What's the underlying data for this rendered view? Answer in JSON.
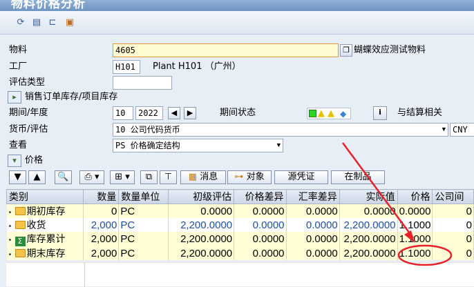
{
  "window": {
    "title": "物料价格分析"
  },
  "toolbar": {
    "icons": [
      "refresh-icon",
      "list-icon",
      "hierarchy-icon",
      "settings-icon"
    ]
  },
  "form": {
    "material": {
      "label": "物料",
      "value": "4605",
      "description": "蝴蝶效应测试物料"
    },
    "plant": {
      "label": "工厂",
      "value": "H101",
      "description": "Plant H101 （广州）"
    },
    "valuation_type": {
      "label": "评估类型",
      "value": ""
    },
    "sales_order_stock": {
      "label": "销售订单库存/项目库存"
    },
    "period_year": {
      "label": "期间/年度",
      "period": "10",
      "year": "2022",
      "status_label": "期间状态",
      "closing_label": "与结算相关"
    },
    "currency": {
      "label": "货币/评估",
      "value": "10 公司代码货币",
      "currency_code": "CNY"
    },
    "view": {
      "label": "查看",
      "value": "PS 价格确定结构"
    },
    "price_section": {
      "label": "价格"
    }
  },
  "alv_toolbar": {
    "messages_label": "消息",
    "objects_label": "对象",
    "source_doc_label": "源凭证",
    "wip_label": "在制品"
  },
  "grid": {
    "columns": [
      "类别",
      "数量",
      "数量单位",
      "初级评估",
      "价格差异",
      "汇率差异",
      "实际值",
      "价格",
      "公司间"
    ],
    "rows": [
      {
        "category": "期初库存",
        "icon": "folder-icon",
        "qty": "0",
        "unit": "PC",
        "prelim": "0.0000",
        "price_diff": "0.0000",
        "exch_diff": "0.0000",
        "actual": "0.0000",
        "price": "0.0000",
        "ic": "0",
        "style": "yellow"
      },
      {
        "category": "收货",
        "icon": "folder-icon",
        "qty": "2,000",
        "unit": "PC",
        "prelim": "2,200.0000",
        "price_diff": "0.0000",
        "exch_diff": "0.0000",
        "actual": "2,200.0000",
        "price": "1.1000",
        "ic": "0",
        "style": "white"
      },
      {
        "category": "库存累计",
        "icon": "sigma-icon",
        "qty": "2,000",
        "unit": "PC",
        "prelim": "2,200.0000",
        "price_diff": "0.0000",
        "exch_diff": "0.0000",
        "actual": "2,200.0000",
        "price": "1.1000",
        "ic": "0",
        "style": "yellow"
      },
      {
        "category": "期末库存",
        "icon": "folder-icon",
        "qty": "2,000",
        "unit": "PC",
        "prelim": "2,200.0000",
        "price_diff": "0.0000",
        "exch_diff": "0.0000",
        "actual": "2,200.0000",
        "price": "1.1000",
        "ic": "0",
        "style": "yellow"
      }
    ]
  },
  "colors": {
    "annotation": "#e8202a",
    "active_field": "#fffcd2",
    "yellow_row": "#fffed4",
    "blue_text": "#1f4fa0"
  }
}
